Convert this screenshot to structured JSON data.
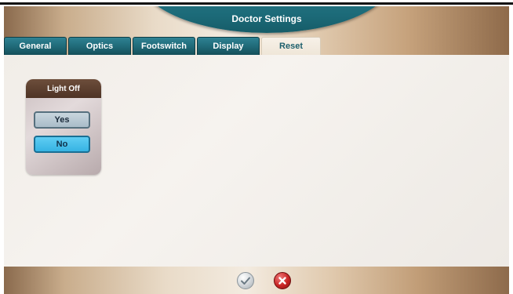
{
  "header": {
    "title": "Doctor Settings"
  },
  "tabs": [
    {
      "label": "General",
      "active": false
    },
    {
      "label": "Optics",
      "active": false
    },
    {
      "label": "Footswitch",
      "active": false
    },
    {
      "label": "Display",
      "active": false
    },
    {
      "label": "Reset",
      "active": true
    }
  ],
  "light_off": {
    "title": "Light Off",
    "options": [
      {
        "label": "Yes",
        "selected": false
      },
      {
        "label": "No",
        "selected": true
      }
    ]
  },
  "footer": {
    "confirm_icon": "checkmark-icon",
    "cancel_icon": "close-icon"
  },
  "colors": {
    "tab_teal": "#1f6876",
    "selected_blue": "#36b3e3",
    "card_header_brown": "#5a3d2e",
    "cancel_red": "#c82424"
  }
}
